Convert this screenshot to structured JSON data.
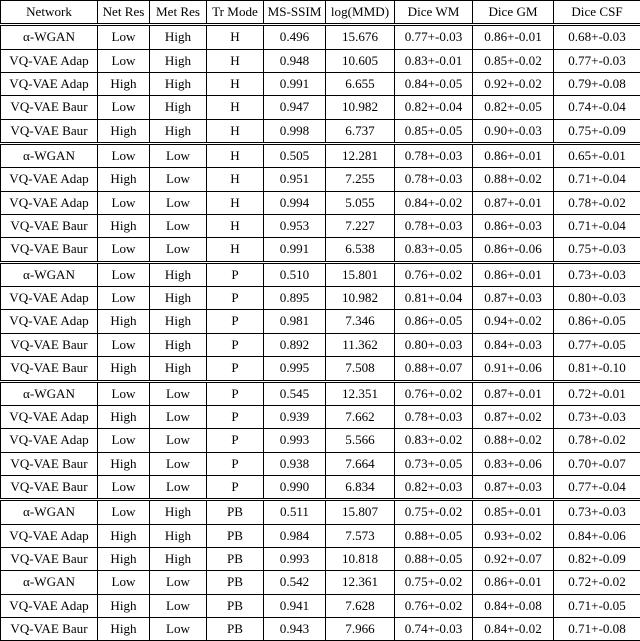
{
  "table": {
    "columns": [
      "Network",
      "Net Res",
      "Met Res",
      "Tr Mode",
      "MS-SSIM",
      "log(MMD)",
      "Dice WM",
      "Dice GM",
      "Dice CSF"
    ],
    "blocks": [
      {
        "rows": [
          {
            "network": "α-WGAN",
            "net_res": "Low",
            "met_res": "High",
            "tr_mode": "H",
            "ms_ssim": "0.496",
            "log_mmd": "15.676",
            "dice_wm": "0.77+-0.03",
            "dice_gm": "0.86+-0.01",
            "dice_csf": "0.68+-0.03",
            "bold": []
          },
          {
            "network": "VQ-VAE Adap",
            "net_res": "Low",
            "met_res": "High",
            "tr_mode": "H",
            "ms_ssim": "0.948",
            "log_mmd": "10.605",
            "dice_wm": "0.83+-0.01",
            "dice_gm": "0.85+-0.02",
            "dice_csf": "0.77+-0.03",
            "bold": []
          },
          {
            "network": "VQ-VAE Adap",
            "net_res": "High",
            "met_res": "High",
            "tr_mode": "H",
            "ms_ssim": "0.991",
            "log_mmd": "6.655",
            "dice_wm": "0.84+-0.05",
            "dice_gm": "0.92+-0.02",
            "dice_csf": "0.79+-0.08",
            "bold": [
              "log_mmd",
              "dice_gm",
              "dice_csf"
            ]
          },
          {
            "network": "VQ-VAE Baur",
            "net_res": "Low",
            "met_res": "High",
            "tr_mode": "H",
            "ms_ssim": "0.947",
            "log_mmd": "10.982",
            "dice_wm": "0.82+-0.04",
            "dice_gm": "0.82+-0.05",
            "dice_csf": "0.74+-0.04",
            "bold": []
          },
          {
            "network": "VQ-VAE Baur",
            "net_res": "High",
            "met_res": "High",
            "tr_mode": "H",
            "ms_ssim": "0.998",
            "log_mmd": "6.737",
            "dice_wm": "0.85+-0.05",
            "dice_gm": "0.90+-0.03",
            "dice_csf": "0.75+-0.09",
            "bold": [
              "ms_ssim",
              "dice_wm"
            ]
          }
        ]
      },
      {
        "rows": [
          {
            "network": "α-WGAN",
            "net_res": "Low",
            "met_res": "Low",
            "tr_mode": "H",
            "ms_ssim": "0.505",
            "log_mmd": "12.281",
            "dice_wm": "0.78+-0.03",
            "dice_gm": "0.86+-0.01",
            "dice_csf": "0.65+-0.01",
            "bold": []
          },
          {
            "network": "VQ-VAE Adap",
            "net_res": "High",
            "met_res": "Low",
            "tr_mode": "H",
            "ms_ssim": "0.951",
            "log_mmd": "7.255",
            "dice_wm": "0.78+-0.03",
            "dice_gm": "0.88+-0.02",
            "dice_csf": "0.71+-0.04",
            "bold": [
              "dice_gm"
            ]
          },
          {
            "network": "VQ-VAE Adap",
            "net_res": "Low",
            "met_res": "Low",
            "tr_mode": "H",
            "ms_ssim": "0.994",
            "log_mmd": "5.055",
            "dice_wm": "0.84+-0.02",
            "dice_gm": "0.87+-0.01",
            "dice_csf": "0.78+-0.02",
            "bold": [
              "ms_ssim",
              "log_mmd",
              "dice_wm",
              "dice_csf"
            ]
          },
          {
            "network": "VQ-VAE Baur",
            "net_res": "High",
            "met_res": "Low",
            "tr_mode": "H",
            "ms_ssim": "0.953",
            "log_mmd": "7.227",
            "dice_wm": "0.78+-0.03",
            "dice_gm": "0.86+-0.03",
            "dice_csf": "0.71+-0.04",
            "bold": []
          },
          {
            "network": "VQ-VAE Baur",
            "net_res": "Low",
            "met_res": "Low",
            "tr_mode": "H",
            "ms_ssim": "0.991",
            "log_mmd": "6.538",
            "dice_wm": "0.83+-0.05",
            "dice_gm": "0.86+-0.06",
            "dice_csf": "0.75+-0.03",
            "bold": []
          }
        ]
      },
      {
        "rows": [
          {
            "network": "α-WGAN",
            "net_res": "Low",
            "met_res": "High",
            "tr_mode": "P",
            "ms_ssim": "0.510",
            "log_mmd": "15.801",
            "dice_wm": "0.76+-0.02",
            "dice_gm": "0.86+-0.01",
            "dice_csf": "0.73+-0.03",
            "bold": []
          },
          {
            "network": "VQ-VAE Adap",
            "net_res": "Low",
            "met_res": "High",
            "tr_mode": "P",
            "ms_ssim": "0.895",
            "log_mmd": "10.982",
            "dice_wm": "0.81+-0.04",
            "dice_gm": "0.87+-0.03",
            "dice_csf": "0.80+-0.03",
            "bold": []
          },
          {
            "network": "VQ-VAE Adap",
            "net_res": "High",
            "met_res": "High",
            "tr_mode": "P",
            "ms_ssim": "0.981",
            "log_mmd": "7.346",
            "dice_wm": "0.86+-0.05",
            "dice_gm": "0.94+-0.02",
            "dice_csf": "0.86+-0.05",
            "bold": [
              "log_mmd",
              "dice_gm",
              "dice_csf"
            ]
          },
          {
            "network": "VQ-VAE Baur",
            "net_res": "Low",
            "met_res": "High",
            "tr_mode": "P",
            "ms_ssim": "0.892",
            "log_mmd": "11.362",
            "dice_wm": "0.80+-0.03",
            "dice_gm": "0.84+-0.03",
            "dice_csf": "0.77+-0.05",
            "bold": []
          },
          {
            "network": "VQ-VAE Baur",
            "net_res": "High",
            "met_res": "High",
            "tr_mode": "P",
            "ms_ssim": "0.995",
            "log_mmd": "7.508",
            "dice_wm": "0.88+-0.07",
            "dice_gm": "0.91+-0.06",
            "dice_csf": "0.81+-0.10",
            "bold": [
              "ms_ssim",
              "dice_wm"
            ]
          }
        ]
      },
      {
        "rows": [
          {
            "network": "α-WGAN",
            "net_res": "Low",
            "met_res": "Low",
            "tr_mode": "P",
            "ms_ssim": "0.545",
            "log_mmd": "12.351",
            "dice_wm": "0.76+-0.02",
            "dice_gm": "0.87+-0.01",
            "dice_csf": "0.72+-0.01",
            "bold": []
          },
          {
            "network": "VQ-VAE Adap",
            "net_res": "High",
            "met_res": "Low",
            "tr_mode": "P",
            "ms_ssim": "0.939",
            "log_mmd": "7.662",
            "dice_wm": "0.78+-0.03",
            "dice_gm": "0.87+-0.02",
            "dice_csf": "0.73+-0.03",
            "bold": []
          },
          {
            "network": "VQ-VAE Adap",
            "net_res": "Low",
            "met_res": "Low",
            "tr_mode": "P",
            "ms_ssim": "0.993",
            "log_mmd": "5.566",
            "dice_wm": "0.83+-0.02",
            "dice_gm": "0.88+-0.02",
            "dice_csf": "0.78+-0.02",
            "bold": [
              "ms_ssim",
              "log_mmd",
              "dice_wm",
              "dice_gm",
              "dice_csf"
            ]
          },
          {
            "network": "VQ-VAE Baur",
            "net_res": "High",
            "met_res": "Low",
            "tr_mode": "P",
            "ms_ssim": "0.938",
            "log_mmd": "7.664",
            "dice_wm": "0.73+-0.05",
            "dice_gm": "0.83+-0.06",
            "dice_csf": "0.70+-0.07",
            "bold": []
          },
          {
            "network": "VQ-VAE Baur",
            "net_res": "Low",
            "met_res": "Low",
            "tr_mode": "P",
            "ms_ssim": "0.990",
            "log_mmd": "6.834",
            "dice_wm": "0.82+-0.03",
            "dice_gm": "0.87+-0.03",
            "dice_csf": "0.77+-0.04",
            "bold": []
          }
        ]
      },
      {
        "rows": [
          {
            "network": "α-WGAN",
            "net_res": "Low",
            "met_res": "High",
            "tr_mode": "PB",
            "ms_ssim": "0.511",
            "log_mmd": "15.807",
            "dice_wm": "0.75+-0.02",
            "dice_gm": "0.85+-0.01",
            "dice_csf": "0.73+-0.03",
            "bold": []
          },
          {
            "network": "VQ-VAE Adap",
            "net_res": "High",
            "met_res": "High",
            "tr_mode": "PB",
            "ms_ssim": "0.984",
            "log_mmd": "7.573",
            "dice_wm": "0.88+-0.05",
            "dice_gm": "0.93+-0.02",
            "dice_csf": "0.84+-0.06",
            "bold": [
              "log_mmd",
              "dice_wm",
              "dice_gm",
              "dice_csf"
            ]
          },
          {
            "network": "VQ-VAE Baur",
            "net_res": "High",
            "met_res": "High",
            "tr_mode": "PB",
            "ms_ssim": "0.993",
            "log_mmd": "10.818",
            "dice_wm": "0.88+-0.05",
            "dice_gm": "0.92+-0.07",
            "dice_csf": "0.82+-0.09",
            "bold": [
              "ms_ssim",
              "dice_wm"
            ]
          },
          {
            "network": "α-WGAN",
            "net_res": "Low",
            "met_res": "Low",
            "tr_mode": "PB",
            "ms_ssim": "0.542",
            "log_mmd": "12.361",
            "dice_wm": "0.75+-0.02",
            "dice_gm": "0.86+-0.01",
            "dice_csf": "0.72+-0.02",
            "bold": [
              "dice_gm",
              "dice_csf"
            ]
          },
          {
            "network": "VQ-VAE Adap",
            "net_res": "High",
            "met_res": "Low",
            "tr_mode": "PB",
            "ms_ssim": "0.941",
            "log_mmd": "7.628",
            "dice_wm": "0.76+-0.02",
            "dice_gm": "0.84+-0.08",
            "dice_csf": "0.71+-0.05",
            "bold": [
              "log_mmd",
              "dice_wm"
            ]
          },
          {
            "network": "VQ-VAE Baur",
            "net_res": "High",
            "met_res": "Low",
            "tr_mode": "PB",
            "ms_ssim": "0.943",
            "log_mmd": "7.966",
            "dice_wm": "0.74+-0.03",
            "dice_gm": "0.84+-0.02",
            "dice_csf": "0.71+-0.08",
            "bold": [
              "ms_ssim"
            ]
          }
        ]
      }
    ]
  }
}
